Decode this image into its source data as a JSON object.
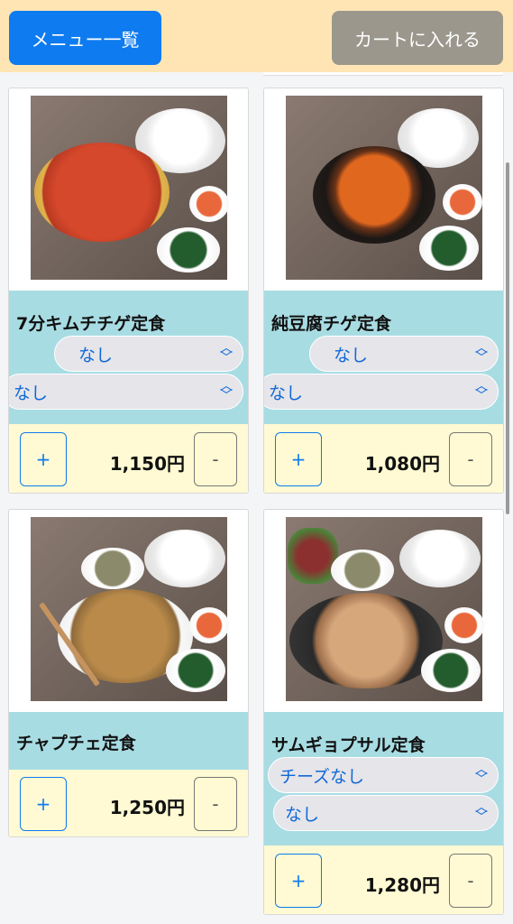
{
  "header": {
    "menu_button": "メニュー一覧",
    "cart_button": "カートに入れる"
  },
  "items": [
    {
      "name": "7分キムチチゲ定食",
      "options": [
        "なし",
        "なし"
      ],
      "price": "1,150円",
      "plus": "+",
      "minus": "-"
    },
    {
      "name": "純豆腐チゲ定食",
      "options": [
        "なし",
        "なし"
      ],
      "price": "1,080円",
      "plus": "+",
      "minus": "-"
    },
    {
      "name": "チャプチェ定食",
      "options": [],
      "price": "1,250円",
      "plus": "+",
      "minus": "-"
    },
    {
      "name": "サムギョプサル定食",
      "options": [
        "チーズなし",
        "なし"
      ],
      "price": "1,280円",
      "plus": "+",
      "minus": "-"
    }
  ],
  "colors": {
    "accent": "#0f7bf0",
    "header_bg": "#ffe5b3",
    "name_bg": "#a8dce3",
    "price_bg": "#fffad3",
    "cart_button_bg": "#9b978d"
  }
}
